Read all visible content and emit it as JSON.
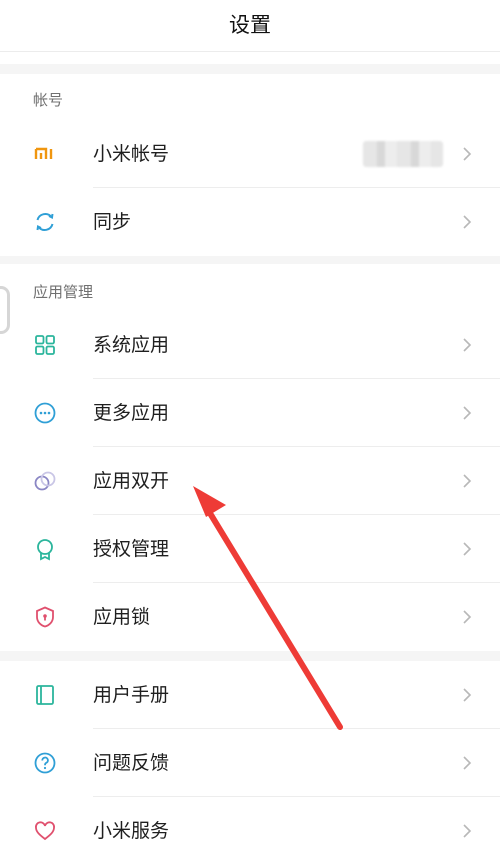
{
  "header": {
    "title": "设置"
  },
  "sections": {
    "account": {
      "label": "帐号",
      "items": [
        {
          "label": "小米帐号",
          "icon": "mi-logo-icon"
        },
        {
          "label": "同步",
          "icon": "sync-icon"
        }
      ]
    },
    "apps": {
      "label": "应用管理",
      "items": [
        {
          "label": "系统应用",
          "icon": "grid-icon"
        },
        {
          "label": "更多应用",
          "icon": "more-dots-icon"
        },
        {
          "label": "应用双开",
          "icon": "dual-rings-icon"
        },
        {
          "label": "授权管理",
          "icon": "badge-icon"
        },
        {
          "label": "应用锁",
          "icon": "shield-lock-icon"
        }
      ]
    },
    "support": {
      "items": [
        {
          "label": "用户手册",
          "icon": "book-icon"
        },
        {
          "label": "问题反馈",
          "icon": "question-icon"
        },
        {
          "label": "小米服务",
          "icon": "heart-icon"
        }
      ]
    }
  },
  "colors": {
    "mi_orange": "#f0960f",
    "teal": "#2bb59c",
    "blue": "#2f9fd6",
    "purple": "#8a86c4",
    "pink": "#e0506e",
    "arrow_red": "#ee3b36"
  }
}
